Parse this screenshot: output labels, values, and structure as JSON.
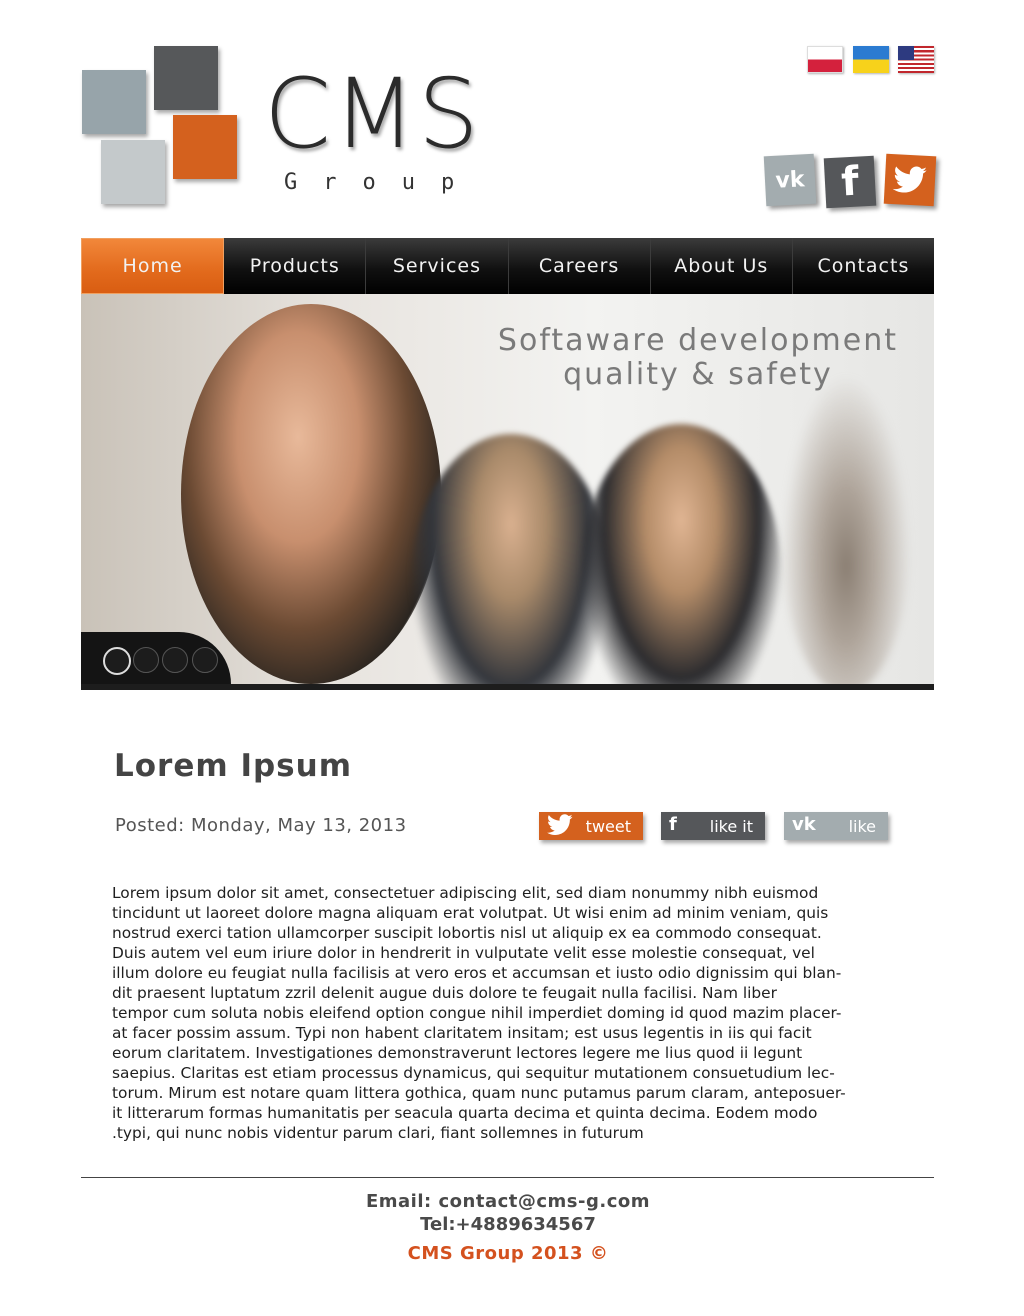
{
  "brand": {
    "name": "CMS",
    "sub": "Group"
  },
  "languages": [
    {
      "code": "pl",
      "icon": "poland-flag-icon"
    },
    {
      "code": "ua",
      "icon": "ukraine-flag-icon"
    },
    {
      "code": "us",
      "icon": "usa-flag-icon"
    }
  ],
  "social": {
    "vk": {
      "icon": "vk-icon",
      "glyph": "vk"
    },
    "facebook": {
      "icon": "facebook-icon",
      "glyph": "f"
    },
    "twitter": {
      "icon": "twitter-icon"
    }
  },
  "nav": {
    "items": [
      {
        "label": "Home",
        "active": true
      },
      {
        "label": "Products",
        "active": false
      },
      {
        "label": "Services",
        "active": false
      },
      {
        "label": "Careers",
        "active": false
      },
      {
        "label": "About Us",
        "active": false
      },
      {
        "label": "Contacts",
        "active": false
      }
    ]
  },
  "hero": {
    "line1": "Softaware development",
    "line2": "quality & safety",
    "slides": 4,
    "active_slide": 1
  },
  "post": {
    "title": "Lorem Ipsum",
    "posted": "Posted: Monday, May 13, 2013",
    "share": {
      "tweet": "tweet",
      "fb_like": "like it",
      "vk_like": "like"
    },
    "body": [
      "Lorem ipsum dolor sit amet, consectetuer adipiscing elit, sed diam nonummy nibh euismod",
      "tincidunt ut laoreet dolore magna aliquam erat volutpat. Ut wisi enim ad minim veniam, quis",
      "nostrud exerci tation ullamcorper suscipit lobortis nisl ut aliquip ex ea commodo consequat.",
      "Duis autem vel eum iriure dolor in hendrerit in vulputate velit esse molestie consequat, vel",
      "illum dolore eu feugiat nulla facilisis at vero eros et accumsan et iusto odio dignissim qui blan-",
      "dit praesent luptatum zzril delenit augue duis dolore te feugait nulla facilisi. Nam liber",
      "tempor cum soluta nobis eleifend option congue nihil imperdiet doming id quod mazim placer-",
      "at facer possim assum. Typi non habent claritatem insitam; est usus legentis in iis qui facit",
      "eorum claritatem. Investigationes demonstraverunt lectores legere me lius quod ii legunt",
      "saepius. Claritas est etiam processus dynamicus, qui sequitur mutationem consuetudium lec-",
      "torum. Mirum est notare quam littera gothica, quam nunc putamus parum claram, anteposuer-",
      "it litterarum formas humanitatis per seacula quarta decima et quinta decima. Eodem modo",
      ".typi, qui nunc nobis videntur parum clari, fiant sollemnes in futurum"
    ]
  },
  "footer": {
    "email": "Email: contact@cms-g.com",
    "tel": "Tel:+4889634567",
    "copyright": "CMS Group 2013 ©"
  },
  "colors": {
    "accent": "#d4611e",
    "dark": "#55575a",
    "gray": "#a3acaf"
  }
}
